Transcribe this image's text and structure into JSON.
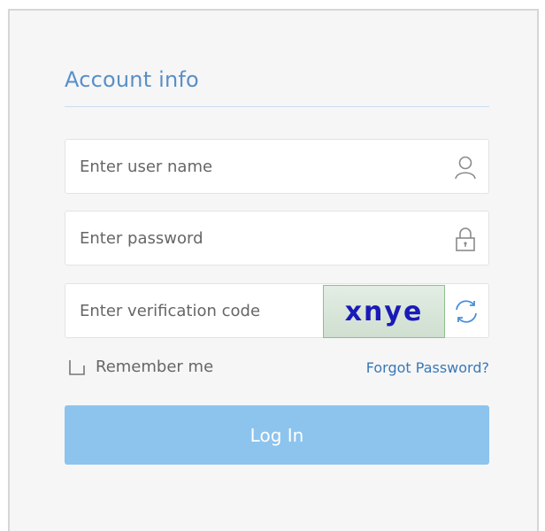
{
  "form": {
    "title": "Account info",
    "username": {
      "value": "",
      "placeholder": "Enter user name",
      "icon": "user-icon"
    },
    "password": {
      "value": "",
      "placeholder": "Enter password",
      "icon": "lock-icon"
    },
    "verification": {
      "value": "",
      "placeholder": "Enter verification code",
      "captcha_text": "xnye",
      "refresh_icon": "refresh-icon"
    },
    "remember_label": "Remember me",
    "remember_checked": false,
    "forgot_label": "Forgot Password?",
    "login_label": "Log In"
  },
  "colors": {
    "accent": "#5a8fc6",
    "button": "#8cc4ee",
    "link": "#3a78b8",
    "captcha_text": "#1a1ab8"
  }
}
